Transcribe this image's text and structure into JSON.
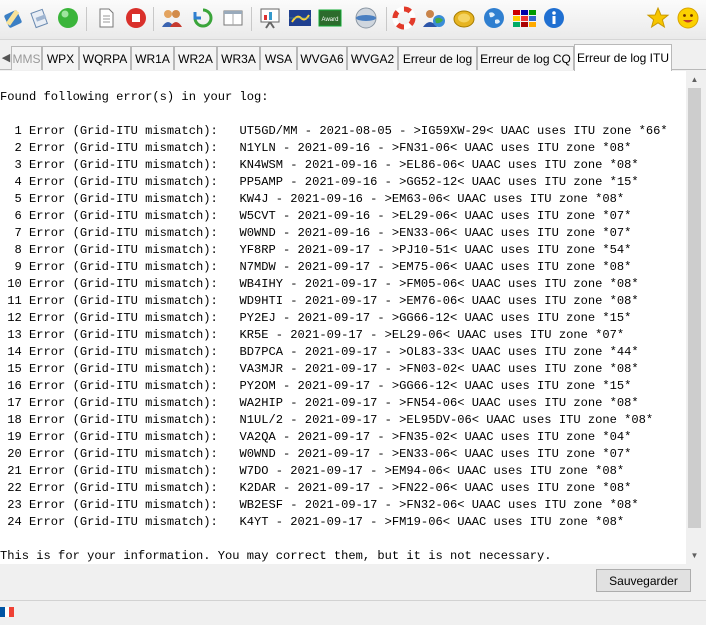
{
  "toolbar": {
    "buttons": [
      {
        "icon": "edit-pencil-icon"
      },
      {
        "icon": "eraser-icon"
      },
      {
        "icon": "green-ball-icon"
      },
      {
        "icon": "new-document-icon"
      },
      {
        "icon": "stop-icon"
      },
      {
        "icon": "users-icon"
      },
      {
        "icon": "refresh-icon"
      },
      {
        "icon": "window-icon"
      },
      {
        "icon": "presentation-chart-icon"
      },
      {
        "icon": "grid-map-icon"
      },
      {
        "icon": "award-certificate-icon"
      },
      {
        "icon": "globe-disc-icon"
      },
      {
        "icon": "lifebuoy-help-icon"
      },
      {
        "icon": "user-globe-icon"
      },
      {
        "icon": "coin-icon"
      },
      {
        "icon": "world-globe-icon"
      },
      {
        "icon": "flags-language-icon"
      },
      {
        "icon": "info-icon"
      },
      {
        "icon": "star-icon"
      },
      {
        "icon": "smiley-icon"
      }
    ]
  },
  "tabs": [
    {
      "label": "MMS",
      "faded": true
    },
    {
      "label": "WPX"
    },
    {
      "label": "WQRPA"
    },
    {
      "label": "WR1A"
    },
    {
      "label": "WR2A"
    },
    {
      "label": "WR3A"
    },
    {
      "label": "WSA"
    },
    {
      "label": "WVGA6"
    },
    {
      "label": "WVGA2"
    },
    {
      "label": "Erreur de log"
    },
    {
      "label": "Erreur de log CQ"
    },
    {
      "label": "Erreur de log ITU",
      "active": true
    }
  ],
  "log": {
    "header": "Found following error(s) in your log:",
    "errors": [
      "  1 Error (Grid-ITU mismatch):   UT5GD/MM - 2021-08-05 - >IG59XW-29< UAAC uses ITU zone *66*",
      "  2 Error (Grid-ITU mismatch):   N1YLN - 2021-09-16 - >FN31-06< UAAC uses ITU zone *08*",
      "  3 Error (Grid-ITU mismatch):   KN4WSM - 2021-09-16 - >EL86-06< UAAC uses ITU zone *08*",
      "  4 Error (Grid-ITU mismatch):   PP5AMP - 2021-09-16 - >GG52-12< UAAC uses ITU zone *15*",
      "  5 Error (Grid-ITU mismatch):   KW4J - 2021-09-16 - >EM63-06< UAAC uses ITU zone *08*",
      "  6 Error (Grid-ITU mismatch):   W5CVT - 2021-09-16 - >EL29-06< UAAC uses ITU zone *07*",
      "  7 Error (Grid-ITU mismatch):   W0WND - 2021-09-16 - >EN33-06< UAAC uses ITU zone *07*",
      "  8 Error (Grid-ITU mismatch):   YF8RP - 2021-09-17 - >PJ10-51< UAAC uses ITU zone *54*",
      "  9 Error (Grid-ITU mismatch):   N7MDW - 2021-09-17 - >EM75-06< UAAC uses ITU zone *08*",
      " 10 Error (Grid-ITU mismatch):   WB4IHY - 2021-09-17 - >FM05-06< UAAC uses ITU zone *08*",
      " 11 Error (Grid-ITU mismatch):   WD9HTI - 2021-09-17 - >EM76-06< UAAC uses ITU zone *08*",
      " 12 Error (Grid-ITU mismatch):   PY2EJ - 2021-09-17 - >GG66-12< UAAC uses ITU zone *15*",
      " 13 Error (Grid-ITU mismatch):   KR5E - 2021-09-17 - >EL29-06< UAAC uses ITU zone *07*",
      " 14 Error (Grid-ITU mismatch):   BD7PCA - 2021-09-17 - >OL83-33< UAAC uses ITU zone *44*",
      " 15 Error (Grid-ITU mismatch):   VA3MJR - 2021-09-17 - >FN03-02< UAAC uses ITU zone *08*",
      " 16 Error (Grid-ITU mismatch):   PY2OM - 2021-09-17 - >GG66-12< UAAC uses ITU zone *15*",
      " 17 Error (Grid-ITU mismatch):   WA2HIP - 2021-09-17 - >FN54-06< UAAC uses ITU zone *08*",
      " 18 Error (Grid-ITU mismatch):   N1UL/2 - 2021-09-17 - >EL95DV-06< UAAC uses ITU zone *08*",
      " 19 Error (Grid-ITU mismatch):   VA2QA - 2021-09-17 - >FN35-02< UAAC uses ITU zone *04*",
      " 20 Error (Grid-ITU mismatch):   W0WND - 2021-09-17 - >EN33-06< UAAC uses ITU zone *07*",
      " 21 Error (Grid-ITU mismatch):   W7DO - 2021-09-17 - >EM94-06< UAAC uses ITU zone *08*",
      " 22 Error (Grid-ITU mismatch):   K2DAR - 2021-09-17 - >FN22-06< UAAC uses ITU zone *08*",
      " 23 Error (Grid-ITU mismatch):   WB2ESF - 2021-09-17 - >FN32-06< UAAC uses ITU zone *08*",
      " 24 Error (Grid-ITU mismatch):   K4YT - 2021-09-17 - >FM19-06< UAAC uses ITU zone *08*"
    ],
    "footer": "This is for your information. You may correct them, but it is not necessary."
  },
  "actions": {
    "save_label": "Sauvegarder"
  },
  "status": {
    "flag_icon": "french-flag-icon",
    "flag_colors": [
      "#0055a4",
      "#ffffff",
      "#ef4135"
    ]
  }
}
